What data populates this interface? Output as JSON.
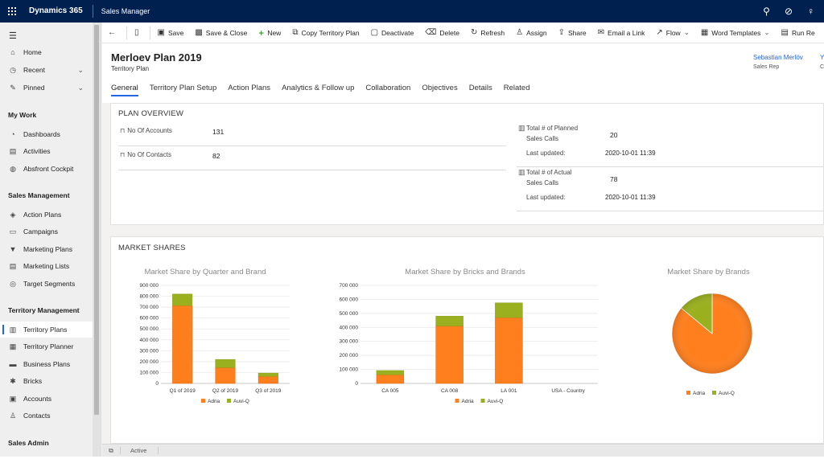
{
  "topbar": {
    "brand": "Dynamics 365",
    "app": "Sales Manager"
  },
  "sidebar": {
    "items": [
      {
        "label": "Home",
        "icon": "⌂"
      },
      {
        "label": "Recent",
        "icon": "◷"
      },
      {
        "label": "Pinned",
        "icon": "✎"
      }
    ],
    "section_mywork": "My Work",
    "mywork": [
      {
        "label": "Dashboards",
        "icon": "◔"
      },
      {
        "label": "Activities",
        "icon": "▤"
      },
      {
        "label": "Absfront Cockpit",
        "icon": "◍"
      }
    ],
    "section_sales": "Sales Management",
    "sales": [
      {
        "label": "Action Plans",
        "icon": "◈"
      },
      {
        "label": "Campaigns",
        "icon": "▭"
      },
      {
        "label": "Marketing Plans",
        "icon": "▼"
      },
      {
        "label": "Marketing Lists",
        "icon": "▤"
      },
      {
        "label": "Target Segments",
        "icon": "◎"
      }
    ],
    "section_territory": "Territory Management",
    "territory": [
      {
        "label": "Territory Plans",
        "icon": "▥"
      },
      {
        "label": "Territory Planner",
        "icon": "▦"
      },
      {
        "label": "Business Plans",
        "icon": "▬"
      },
      {
        "label": "Bricks",
        "icon": "✱"
      },
      {
        "label": "Accounts",
        "icon": "▣"
      },
      {
        "label": "Contacts",
        "icon": "♙"
      }
    ],
    "section_admin": "Sales Admin"
  },
  "commands": {
    "save": "Save",
    "save_close": "Save & Close",
    "new": "New",
    "copy": "Copy Territory Plan",
    "deactivate": "Deactivate",
    "delete": "Delete",
    "refresh": "Refresh",
    "assign": "Assign",
    "share": "Share",
    "email_link": "Email a Link",
    "flow": "Flow",
    "word_templates": "Word Templates",
    "run_report": "Run Re"
  },
  "record": {
    "title": "Merloev Plan 2019",
    "entity": "Territory Plan",
    "owner_name": "Sebastian Merlöv",
    "owner_role": "Sales Rep",
    "owner2_name": "Y",
    "owner2_role": "C"
  },
  "tabs": [
    "General",
    "Territory Plan Setup",
    "Action Plans",
    "Analytics & Follow up",
    "Collaboration",
    "Objectives",
    "Details",
    "Related"
  ],
  "plan_overview": {
    "title": "PLAN OVERVIEW",
    "accounts_label": "No Of Accounts",
    "accounts_value": "131",
    "contacts_label": "No Of Contacts",
    "contacts_value": "82",
    "planned_label_1": "Total # of Planned",
    "planned_label_2": "Sales Calls",
    "planned_value": "20",
    "planned_updated_label": "Last updated:",
    "planned_updated_value": "2020-10-01 11:39",
    "actual_label_1": "Total # of Actual",
    "actual_label_2": "Sales Calls",
    "actual_value": "78",
    "actual_updated_label": "Last updated:",
    "actual_updated_value": "2020-10-01 11:39"
  },
  "market_shares": {
    "title": "MARKET SHARES"
  },
  "colors": {
    "adria": "#ff7f1e",
    "auvi": "#9bb01f",
    "accent": "#2266e3",
    "topbar": "#002050"
  },
  "chart_data": [
    {
      "type": "bar",
      "stacked": true,
      "title": "Market Share by Quarter and Brand",
      "categories": [
        "Q1 of 2019",
        "Q2 of 2019",
        "Q3 of 2019"
      ],
      "series": [
        {
          "name": "Adria",
          "values": [
            715000,
            145000,
            65000
          ]
        },
        {
          "name": "Auvi-Q",
          "values": [
            105000,
            75000,
            30000
          ]
        }
      ],
      "ylim": [
        0,
        900000
      ],
      "yticks": [
        "0",
        "100 000",
        "200 000",
        "300 000",
        "400 000",
        "500 000",
        "600 000",
        "700 000",
        "800 000",
        "900 000"
      ],
      "grid": true,
      "legend": "bottom"
    },
    {
      "type": "bar",
      "stacked": true,
      "title": "Market Share by Bricks and Brands",
      "categories": [
        "CA 005",
        "CA 008",
        "LA 001",
        "USA - Country"
      ],
      "series": [
        {
          "name": "Adria",
          "values": [
            62000,
            410000,
            470000,
            0
          ]
        },
        {
          "name": "Auvi-Q",
          "values": [
            30000,
            70000,
            105000,
            0
          ]
        }
      ],
      "ylim": [
        0,
        700000
      ],
      "yticks": [
        "0",
        "100 000",
        "200 000",
        "300 000",
        "400 000",
        "500 000",
        "600 000",
        "700 000"
      ],
      "grid": true,
      "legend": "bottom"
    },
    {
      "type": "pie",
      "title": "Market Share by Brands",
      "categories": [
        "Adria",
        "Auvi-Q"
      ],
      "values": [
        86,
        14
      ],
      "legend": "bottom"
    }
  ],
  "status": {
    "state": "Active"
  }
}
